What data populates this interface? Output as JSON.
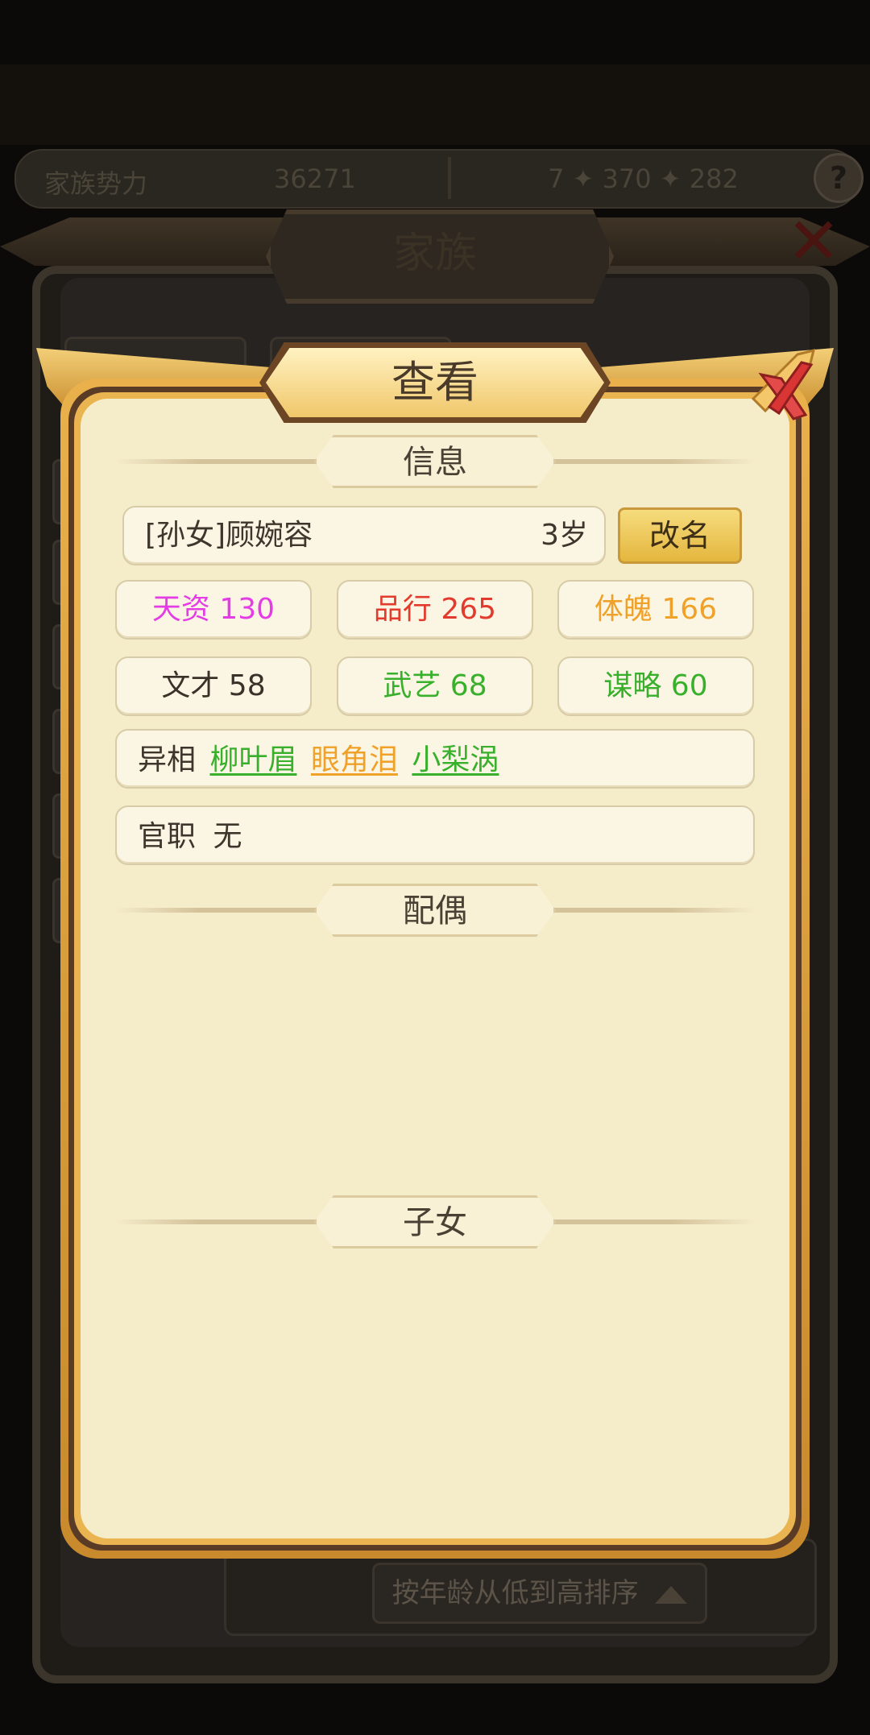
{
  "background": {
    "clan_power_label": "家族势力",
    "clan_power_value": "36271",
    "resources_text": "7 ✦ 370 ✦ 282",
    "panel_title": "家族",
    "sort_button_label": "按年龄从低到高排序"
  },
  "dialog": {
    "title": "查看",
    "sections": {
      "info": "信息",
      "spouse": "配偶",
      "children": "子女"
    },
    "member": {
      "name": "[孙女]顾婉容",
      "age": "3岁",
      "rename_label": "改名"
    },
    "stats": [
      {
        "label": "天资 130",
        "color": "#e53de6"
      },
      {
        "label": "品行 265",
        "color": "#e23b2e"
      },
      {
        "label": "体魄 166",
        "color": "#f0a12a"
      },
      {
        "label": "文才 58",
        "color": "#3a3128"
      },
      {
        "label": "武艺 68",
        "color": "#38b02c"
      },
      {
        "label": "谋略 60",
        "color": "#38b02c"
      }
    ],
    "traits": {
      "label": "异相",
      "items": [
        {
          "name": "柳叶眉",
          "color": "#38b02c"
        },
        {
          "name": "眼角泪",
          "color": "#f0a12a"
        },
        {
          "name": "小梨涡",
          "color": "#38b02c"
        }
      ]
    },
    "office": {
      "label": "官职",
      "value": "无"
    }
  },
  "icons": {
    "close": "close-icon",
    "help": "help-icon",
    "sort": "triangle-up-icon"
  }
}
